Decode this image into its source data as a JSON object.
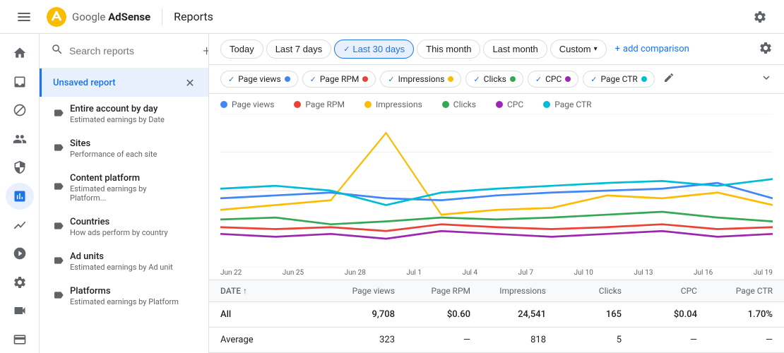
{
  "header": {
    "logo_name": "Google AdSense",
    "title": "Reports",
    "settings_icon": "⚙"
  },
  "date_filters": {
    "today_label": "Today",
    "last7_label": "Last 7 days",
    "last30_label": "Last 30 days",
    "thismonth_label": "This month",
    "lastmonth_label": "Last month",
    "custom_label": "Custom",
    "add_comparison_label": "add comparison",
    "active": "last30"
  },
  "metric_chips": [
    {
      "id": "page_views",
      "label": "Page views",
      "color": "#4285f4",
      "active": true
    },
    {
      "id": "page_rpm",
      "label": "Page RPM",
      "color": "#ea4335",
      "active": true
    },
    {
      "id": "impressions",
      "label": "Impressions",
      "color": "#fbbc04",
      "active": true
    },
    {
      "id": "clicks",
      "label": "Clicks",
      "color": "#34a853",
      "active": true
    },
    {
      "id": "cpc",
      "label": "CPC",
      "color": "#9c27b0",
      "active": true
    },
    {
      "id": "page_ctr",
      "label": "Page CTR",
      "color": "#00bcd4",
      "active": true
    }
  ],
  "chart_legend": [
    {
      "label": "Page views",
      "color": "#4285f4"
    },
    {
      "label": "Page RPM",
      "color": "#ea4335"
    },
    {
      "label": "Impressions",
      "color": "#fbbc04"
    },
    {
      "label": "Clicks",
      "color": "#34a853"
    },
    {
      "label": "CPC",
      "color": "#9c27b0"
    },
    {
      "label": "Page CTR",
      "color": "#00bcd4"
    }
  ],
  "chart_x_labels": [
    "Jun 22",
    "Jun 25",
    "Jun 28",
    "Jul 1",
    "Jul 4",
    "Jul 7",
    "Jul 10",
    "Jul 13",
    "Jul 16",
    "Jul 19"
  ],
  "table": {
    "headers": [
      "DATE ↑",
      "Page views",
      "Page RPM",
      "Impressions",
      "Clicks",
      "CPC",
      "Page CTR"
    ],
    "rows": [
      {
        "date": "All",
        "page_views": "9,708",
        "page_rpm": "$0.60",
        "impressions": "24,541",
        "clicks": "165",
        "cpc": "$0.04",
        "page_ctr": "1.70%"
      },
      {
        "date": "Average",
        "page_views": "323",
        "page_rpm": "—",
        "impressions": "818",
        "clicks": "5",
        "cpc": "—",
        "page_ctr": "—"
      }
    ]
  },
  "sidebar": {
    "search_placeholder": "Search reports",
    "unsaved_label": "Unsaved report",
    "reports": [
      {
        "title": "Entire account by day",
        "subtitle": "Estimated earnings by Date",
        "icon": "~"
      },
      {
        "title": "Sites",
        "subtitle": "Performance of each site",
        "icon": "~"
      },
      {
        "title": "Content platform",
        "subtitle": "Estimated earnings by Platform...",
        "icon": "~"
      },
      {
        "title": "Countries",
        "subtitle": "How ads perform by country",
        "icon": "~"
      },
      {
        "title": "Ad units",
        "subtitle": "Estimated earnings by Ad unit",
        "icon": "~"
      },
      {
        "title": "Platforms",
        "subtitle": "Estimated earnings by Platform",
        "icon": "~"
      }
    ]
  },
  "nav_icons": [
    {
      "id": "home",
      "label": "Home",
      "icon": "home"
    },
    {
      "id": "inbox",
      "label": "Inbox",
      "icon": "inbox"
    },
    {
      "id": "block",
      "label": "Block",
      "icon": "block"
    },
    {
      "id": "people",
      "label": "People",
      "icon": "people"
    },
    {
      "id": "policy",
      "label": "Policy",
      "icon": "policy"
    },
    {
      "id": "reports",
      "label": "Reports",
      "icon": "reports",
      "active": true
    },
    {
      "id": "analytics",
      "label": "Analytics",
      "icon": "analytics"
    },
    {
      "id": "optimization",
      "label": "Optimization",
      "icon": "optimization"
    },
    {
      "id": "settings",
      "label": "Settings",
      "icon": "settings"
    },
    {
      "id": "video",
      "label": "Video",
      "icon": "video"
    },
    {
      "id": "payments",
      "label": "Payments",
      "icon": "payments"
    }
  ]
}
